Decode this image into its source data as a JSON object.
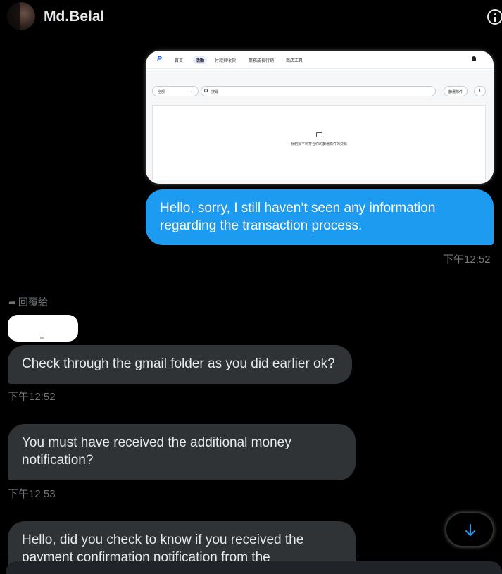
{
  "header": {
    "name": "Md.Belal"
  },
  "attachment": {
    "tabs": [
      "首頁",
      "活動",
      "付款與收款",
      "業務成長行銷",
      "商店工具"
    ],
    "active_tab": "活動",
    "filter_select": "全部",
    "search_placeholder": "搜尋",
    "filter_button": "篩選條件",
    "empty_text": "我們找不到符合你的篩選條件的交易"
  },
  "messages": [
    {
      "direction": "out",
      "text": "Hello, sorry, I still haven’t seen any information regarding the transaction process.",
      "time": "下午12:52"
    },
    {
      "direction": "in",
      "reply_label": "回覆給",
      "text": "Check through the gmail folder as you did earlier ok?",
      "time": "下午12:52"
    },
    {
      "direction": "in",
      "text": "You must have received the additional money notification?",
      "time": "下午12:53"
    },
    {
      "direction": "in",
      "text": "Hello, did you check to know if you received the payment confirmation notification from the"
    }
  ],
  "icons": {
    "info": "info-icon",
    "scroll_down": "arrow-down-icon",
    "reply": "reply-arrow-icon"
  },
  "colors": {
    "background": "#000000",
    "outgoing_bubble": "#1d9bf0",
    "incoming_bubble": "#2f3336",
    "timestamp": "#71767b"
  }
}
